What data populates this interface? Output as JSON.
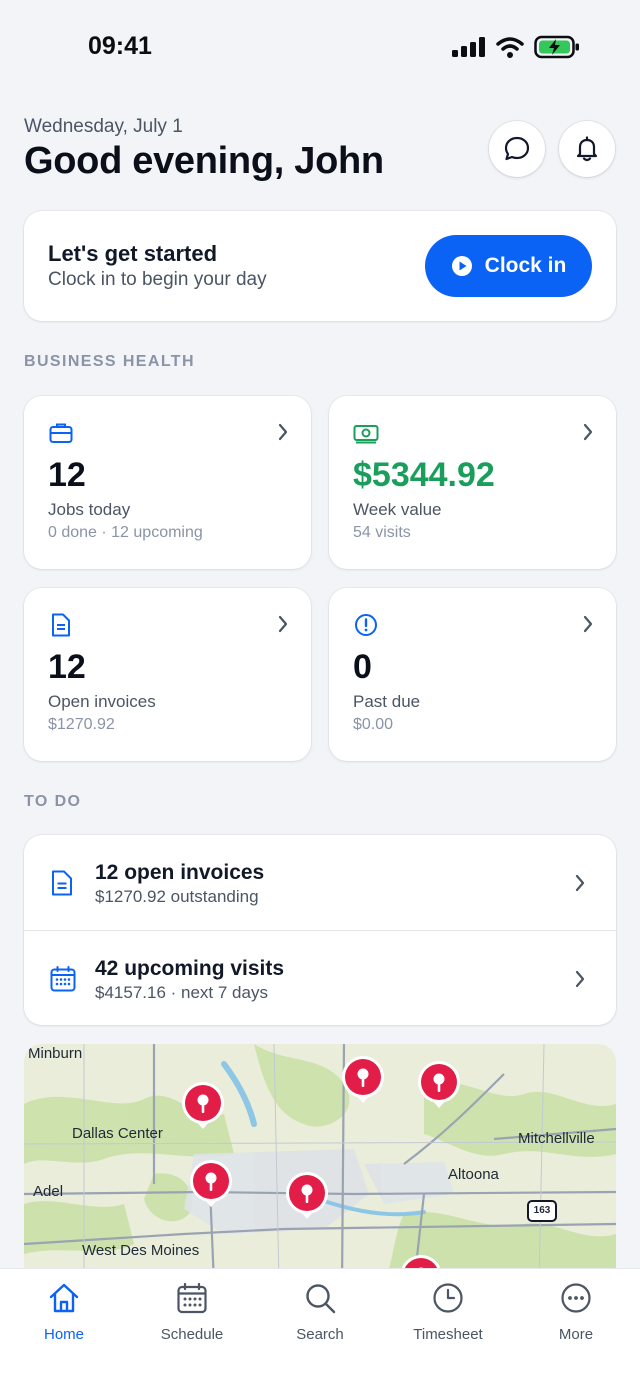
{
  "status": {
    "time": "09:41"
  },
  "header": {
    "date": "Wednesday, July 1",
    "greeting": "Good evening, John"
  },
  "clock_card": {
    "title": "Let's get started",
    "subtitle": "Clock in to begin your day",
    "button_label": "Clock in"
  },
  "business_health": {
    "title": "BUSINESS HEALTH",
    "tiles": [
      {
        "icon": "briefcase-icon",
        "value": "12",
        "label": "Jobs today",
        "sub": "0 done · 12 upcoming"
      },
      {
        "icon": "money-icon",
        "value": "$5344.92",
        "label": "Week value",
        "sub": "54 visits"
      },
      {
        "icon": "invoice-icon",
        "value": "12",
        "label": "Open invoices",
        "sub": "$1270.92"
      },
      {
        "icon": "alert-circle-icon",
        "value": "0",
        "label": "Past due",
        "sub": "$0.00"
      }
    ]
  },
  "todo": {
    "title": "TO DO",
    "items": [
      {
        "icon": "invoice-icon",
        "title": "12 open invoices",
        "sub": "$1270.92 outstanding"
      },
      {
        "icon": "calendar-icon",
        "title": "42 upcoming visits",
        "sub": "$4157.16 · next 7 days"
      }
    ]
  },
  "map": {
    "labels": [
      "Minburn",
      "Dallas Center",
      "Adel",
      "West Des Moines",
      "Mitchellville",
      "Altoona",
      "163"
    ]
  },
  "tabbar": {
    "tabs": [
      {
        "icon": "home-icon",
        "label": "Home"
      },
      {
        "icon": "calendar-icon",
        "label": "Schedule"
      },
      {
        "icon": "search-icon",
        "label": "Search"
      },
      {
        "icon": "clock-icon",
        "label": "Timesheet"
      },
      {
        "icon": "more-icon",
        "label": "More"
      }
    ]
  },
  "colors": {
    "accent": "#0b63f6",
    "positive": "#1a9e5b",
    "pin": "#e11d48"
  }
}
